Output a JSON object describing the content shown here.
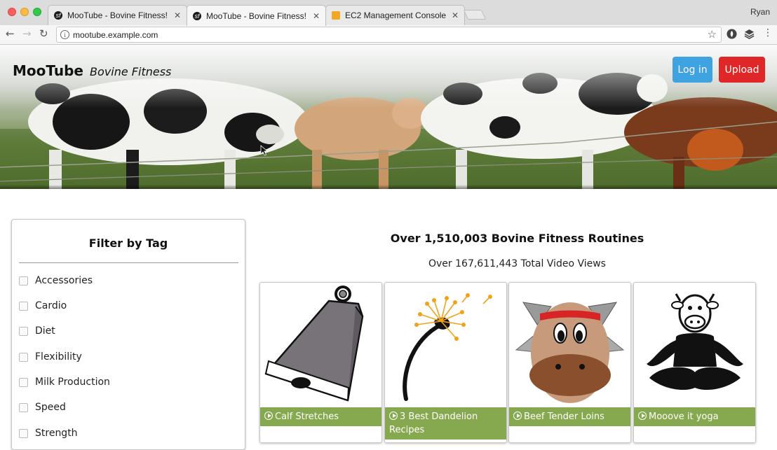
{
  "browser": {
    "tabs": [
      {
        "title": "MooTube - Bovine Fitness!",
        "favicon": "symfony-icon"
      },
      {
        "title": "MooTube - Bovine Fitness!",
        "favicon": "symfony-icon"
      },
      {
        "title": "EC2 Management Console",
        "favicon": "aws-icon"
      }
    ],
    "active_tab": 1,
    "profile": "Ryan",
    "url": "mootube.example.com"
  },
  "header": {
    "brand": "MooTube",
    "tagline": "Bovine Fitness",
    "login_label": "Log in",
    "upload_label": "Upload",
    "login_color": "#3ea3e0",
    "upload_color": "#e02727"
  },
  "filter": {
    "title": "Filter by Tag",
    "tags": [
      "Accessories",
      "Cardio",
      "Diet",
      "Flexibility",
      "Milk Production",
      "Speed",
      "Strength"
    ]
  },
  "main": {
    "headline": "Over 1,510,003 Bovine Fitness Routines",
    "views": "Over 167,611,443 Total Video Views",
    "videos": [
      {
        "title": "Calf Stretches",
        "art": "cowbell-icon"
      },
      {
        "title": "3 Best Dandelion Recipes",
        "art": "dandelion-icon"
      },
      {
        "title": "Beef Tender Loins",
        "art": "cow-face-icon"
      },
      {
        "title": "Mooove it yoga",
        "art": "yoga-cow-icon"
      }
    ],
    "caption_color": "#86a84e"
  }
}
